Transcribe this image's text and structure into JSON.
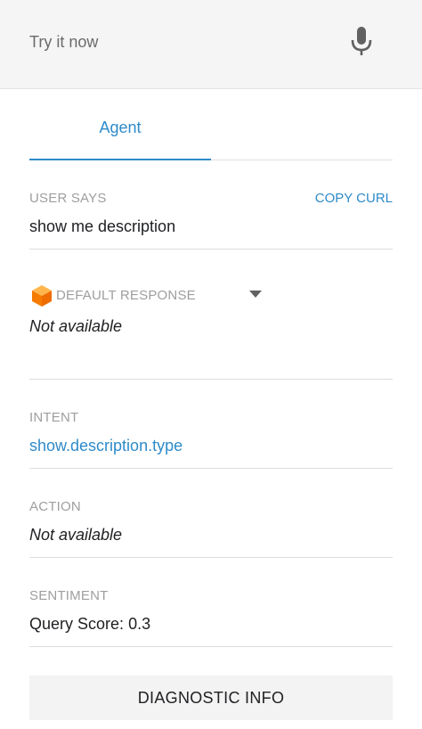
{
  "test_console": {
    "input_placeholder": "Try it now",
    "mic_icon": "microphone-icon"
  },
  "tabs": [
    {
      "label": "Agent",
      "active": true
    }
  ],
  "user_says": {
    "label": "USER SAYS",
    "copy_curl": "COPY CURL",
    "value": "show me description"
  },
  "default_response": {
    "icon": "cube-icon",
    "label": "DEFAULT RESPONSE",
    "dropdown_icon": "caret-down-icon",
    "value": "Not available"
  },
  "intent": {
    "label": "INTENT",
    "value": "show.description.type"
  },
  "action": {
    "label": "ACTION",
    "value": "Not available"
  },
  "sentiment": {
    "label": "SENTIMENT",
    "score_label": "Query Score:",
    "score_value": "0.3"
  },
  "diagnostic_button": "DIAGNOSTIC INFO",
  "colors": {
    "accent": "#2e8bc9",
    "cube_orange": "#f57c00",
    "label_gray": "#9e9e9e"
  }
}
